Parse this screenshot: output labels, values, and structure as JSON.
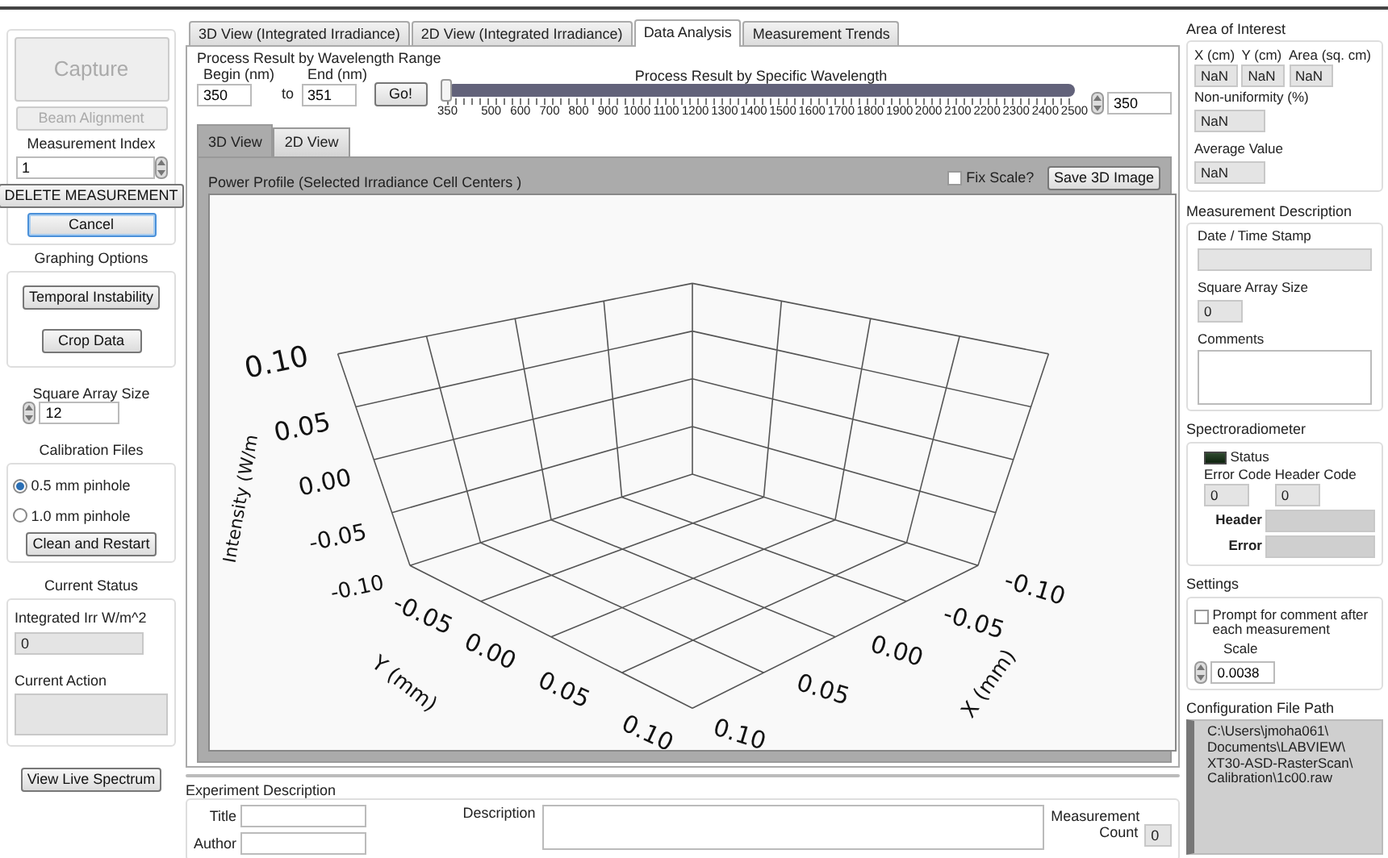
{
  "left_panel": {
    "capture": {
      "label": "Capture",
      "disabled": true
    },
    "beam_alignment": {
      "label": "Beam Alignment",
      "disabled": true
    },
    "measurement_index": {
      "label": "Measurement Index",
      "value": "1"
    },
    "delete_button": "DELETE MEASUREMENT",
    "cancel_button": {
      "label": "Cancel",
      "focused": true
    },
    "graphing_options": {
      "title": "Graphing Options",
      "buttons": [
        "Temporal Instability",
        "Crop Data"
      ]
    },
    "square_array_size": {
      "label": "Square Array Size",
      "value": "12"
    },
    "calibration_files": {
      "title": "Calibration Files",
      "options": [
        {
          "label": "0.5 mm pinhole",
          "selected": true
        },
        {
          "label": "1.0 mm pinhole",
          "selected": false
        }
      ],
      "button": "Clean and Restart"
    },
    "current_status": {
      "title": "Current Status",
      "integrated_label": "Integrated Irr W/m^2",
      "integrated_value": "0",
      "action_label": "Current Action"
    },
    "live_spectrum_button": "View Live Spectrum"
  },
  "tabs": [
    {
      "label": "3D View (Integrated Irradiance)",
      "selected": false
    },
    {
      "label": "2D View (Integrated Irradiance)",
      "selected": false
    },
    {
      "label": "Data Analysis",
      "selected": true
    },
    {
      "label": "Measurement Trends",
      "selected": false
    }
  ],
  "data_analysis": {
    "range_title": "Process  Result by Wavelength Range",
    "begin": {
      "label": "Begin (nm)",
      "value": "350"
    },
    "to": "to",
    "end": {
      "label": "End (nm)",
      "value": "351"
    },
    "go_button": "Go!",
    "wavelength_slider": {
      "title": "Process Result by Specific Wavelength",
      "level": 0,
      "value": "350",
      "ticks": [
        "350",
        "500",
        "600",
        "700",
        "800",
        "900",
        "1000",
        "1100",
        "1200",
        "1300",
        "1400",
        "1500",
        "1600",
        "1700",
        "1800",
        "1900",
        "2000",
        "2100",
        "2200",
        "2300",
        "2400",
        "2500"
      ]
    },
    "view_tabs": [
      {
        "label": "3D View",
        "selected": true
      },
      {
        "label": "2D View",
        "selected": false
      }
    ],
    "plot": {
      "title": "Power Profile (Selected Irradiance Cell Centers )",
      "fix_scale": {
        "label": "Fix Scale?",
        "checked": false
      },
      "save_button": "Save 3D Image",
      "z_label": "Intensity (W/m",
      "z_ticks": [
        "0.10",
        "0.05",
        "0.00",
        "-0.05",
        "-0.10"
      ],
      "y_label": "Y (mm)",
      "y_ticks": [
        "-0.05",
        "0.00",
        "0.05",
        "0.10"
      ],
      "x_label": "X (mm)",
      "x_ticks": [
        "-0.10",
        "-0.05",
        "0.00",
        "0.05",
        "0.10"
      ]
    }
  },
  "experiment": {
    "title": "Experiment Description",
    "title_label": "Title",
    "author_label": "Author",
    "description_label": "Description",
    "count_label": "Measurement Count",
    "count_value": "0"
  },
  "area_of_interest": {
    "title": "Area of Interest",
    "fields": [
      {
        "label": "X (cm)",
        "value": "NaN"
      },
      {
        "label": "Y (cm)",
        "value": "NaN"
      },
      {
        "label": "Area (sq. cm)",
        "value": "NaN"
      }
    ],
    "non_uniformity": {
      "label": "Non-uniformity (%)",
      "value": "NaN"
    },
    "average": {
      "label": "Average Value",
      "value": "NaN"
    }
  },
  "measurement_description": {
    "title": "Measurement Description",
    "date_label": "Date / Time Stamp",
    "size_label": "Square Array Size",
    "size_value": "0",
    "comments_label": "Comments"
  },
  "spectroradiometer": {
    "title": "Spectroradiometer",
    "status": {
      "label": "Status",
      "on": false
    },
    "error_code": {
      "label": "Error Code",
      "value": "0"
    },
    "header_code": {
      "label": "Header Code",
      "value": "0"
    },
    "header_label": "Header",
    "error_label": "Error"
  },
  "settings": {
    "title": "Settings",
    "prompt": {
      "label": "Prompt for comment after each measurement",
      "checked": false
    },
    "scale": {
      "label": "Scale",
      "value": "0.0038"
    }
  },
  "config_path": {
    "title": "Configuration File Path",
    "value": "C:\\Users\\jmoha061\\Documents\\LABVIEW\\XT30-ASD-RasterScan\\Calibration\\1c00.raw"
  }
}
